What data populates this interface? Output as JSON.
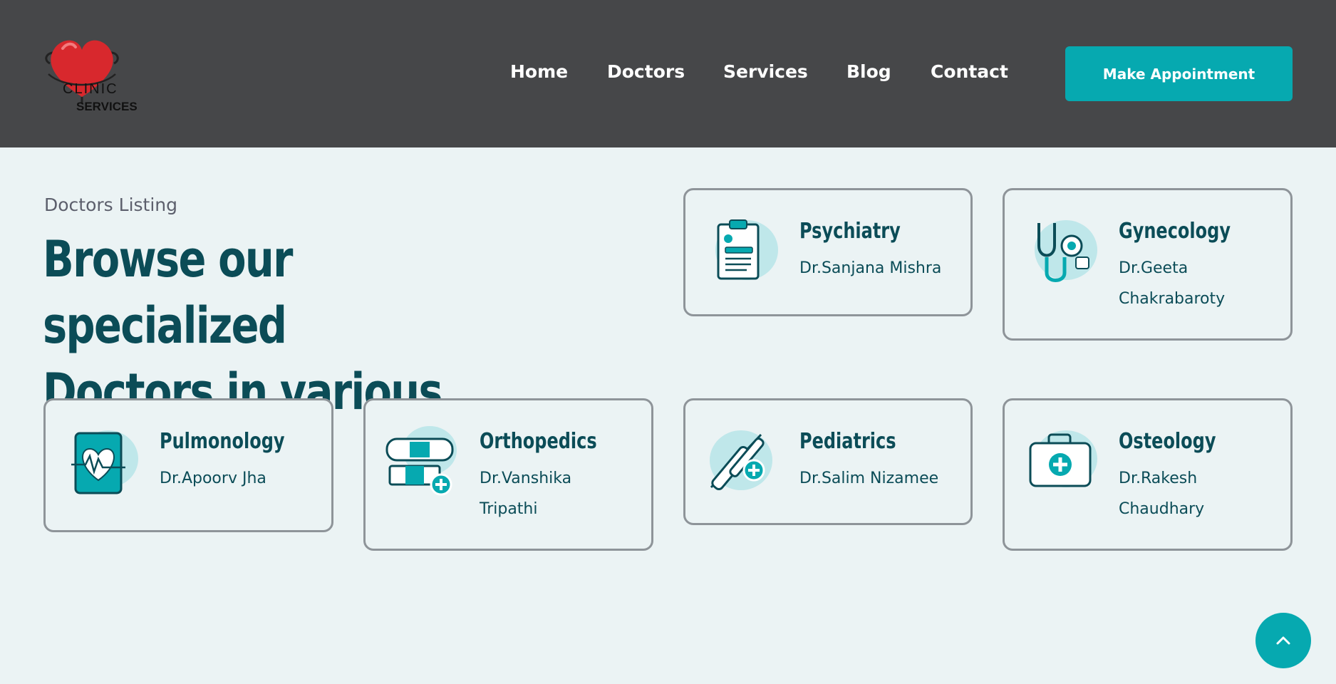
{
  "logo": {
    "line1": "CLINIC",
    "line2": "SERVICES"
  },
  "nav": {
    "items": [
      "Home",
      "Doctors",
      "Services",
      "Blog",
      "Contact"
    ],
    "cta": "Make Appointment"
  },
  "intro": {
    "eyebrow": "Doctors Listing",
    "headline_line1": "Browse our specialized",
    "headline_line2": "Doctors in various fields"
  },
  "cards": [
    {
      "specialty": "Psychiatry",
      "doctor": "Dr.Sanjana Mishra",
      "icon": "clipboard-icon"
    },
    {
      "specialty": "Gynecology",
      "doctor": "Dr.Geeta Chakrabaroty",
      "icon": "stethoscope-icon"
    },
    {
      "specialty": "Pulmonology",
      "doctor": "Dr.Apoorv Jha",
      "icon": "heart-monitor-icon"
    },
    {
      "specialty": "Orthopedics",
      "doctor": "Dr.Vanshika Tripathi",
      "icon": "bandage-icon"
    },
    {
      "specialty": "Pediatrics",
      "doctor": "Dr.Salim Nizamee",
      "icon": "syringe-icon"
    },
    {
      "specialty": "Osteology",
      "doctor": "Dr.Rakesh Chaudhary",
      "icon": "first-aid-kit-icon"
    }
  ],
  "colors": {
    "header_bg": "#464749",
    "accent": "#06a9b0",
    "heading": "#0b4c57",
    "page_bg": "#ebf3f4"
  }
}
